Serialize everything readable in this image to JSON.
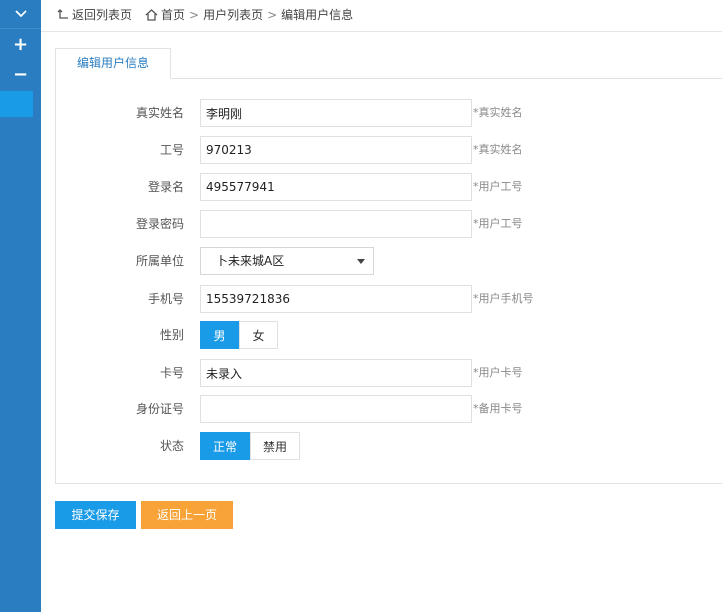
{
  "sidebar": {
    "toggle_icon": "chevron-down-icon",
    "expand_label": "+",
    "collapse_label": "−"
  },
  "topbar": {
    "back_label": "返回列表页",
    "breadcrumb": [
      "首页",
      "用户列表页",
      "编辑用户信息"
    ]
  },
  "tab": {
    "label": "编辑用户信息"
  },
  "form": {
    "real_name": {
      "label": "真实姓名",
      "value": "李明刚",
      "hint": "*真实姓名"
    },
    "job_no": {
      "label": "工号",
      "value": "970213",
      "hint": "*真实姓名"
    },
    "login_name": {
      "label": "登录名",
      "value": "495577941",
      "hint": "*用户工号"
    },
    "password": {
      "label": "登录密码",
      "value": "",
      "hint": "*用户工号"
    },
    "unit": {
      "label": "所属单位",
      "value": "卜未来城A区"
    },
    "phone": {
      "label": "手机号",
      "value": "15539721836",
      "hint": "*用户手机号"
    },
    "gender": {
      "label": "性别",
      "options": [
        "男",
        "女"
      ],
      "selected": "男"
    },
    "card_no": {
      "label": "卡号",
      "value": "未录入",
      "hint": "*用户卡号"
    },
    "id_no": {
      "label": "身份证号",
      "value": "",
      "hint": "*备用卡号"
    },
    "status": {
      "label": "状态",
      "options": [
        "正常",
        "禁用"
      ],
      "selected": "正常"
    }
  },
  "actions": {
    "save_label": "提交保存",
    "back_label": "返回上一页"
  },
  "colors": {
    "sidebar": "#2a7dc0",
    "primary": "#1a9be8",
    "warning": "#f7a337"
  }
}
